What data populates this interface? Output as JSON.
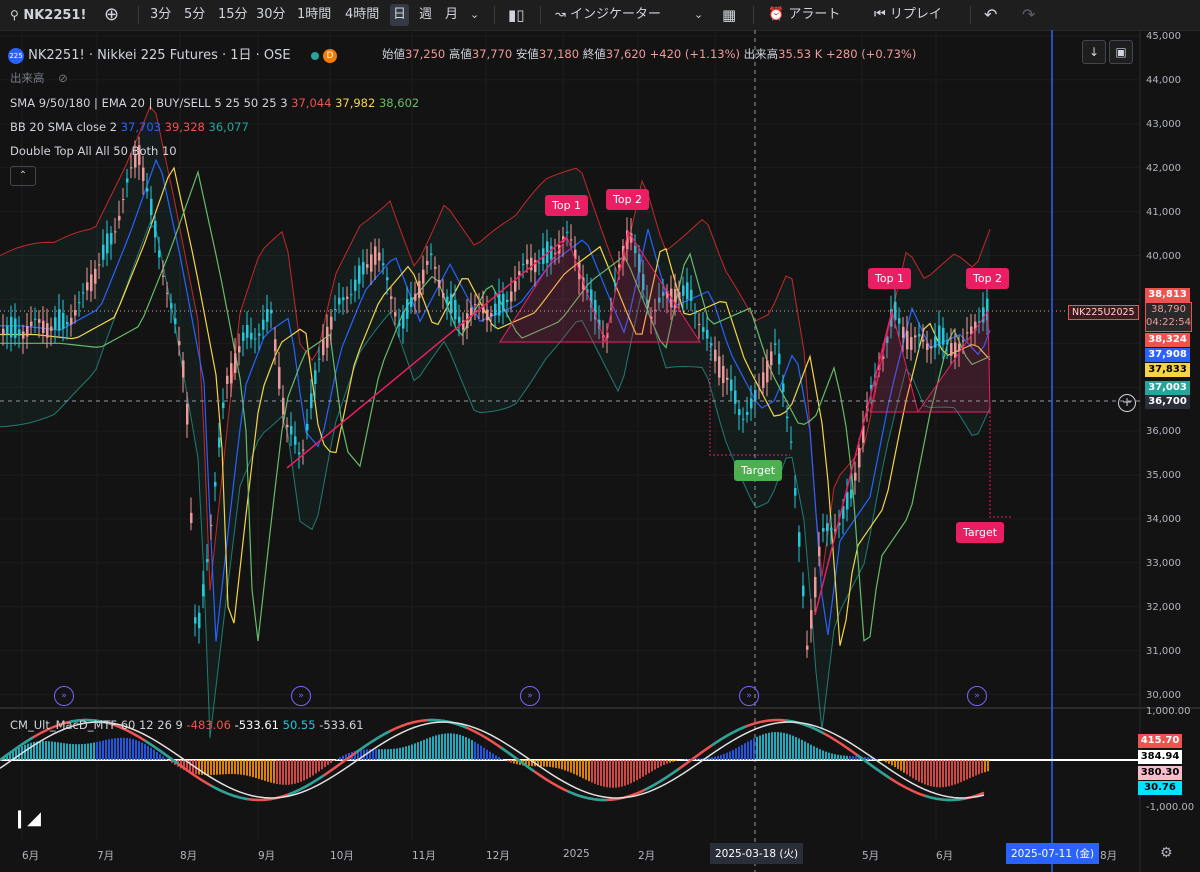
{
  "toolbar": {
    "symbol": "NK2251!",
    "intervals": [
      "3分",
      "5分",
      "15分",
      "30分",
      "1時間",
      "4時間",
      "日",
      "週",
      "月"
    ],
    "active_interval": "日",
    "indicators_label": "インジケーター",
    "alert_label": "アラート",
    "replay_label": "リプレイ"
  },
  "header": {
    "title": "NK2251! · Nikkei 225 Futures · 1日 · OSE",
    "open_label": "始値",
    "open": "37,250",
    "high_label": "高値",
    "high": "37,770",
    "low_label": "安値",
    "low": "37,180",
    "close_label": "終値",
    "close": "37,620",
    "change": "+420 (+1.13%)",
    "volume_label": "出来高",
    "volume": "35.53 K",
    "volume_change": "+280 (+0.73%)",
    "volume_row": "出来高"
  },
  "indicators": {
    "sma_label": "SMA 9/50/180 | EMA 20 | BUY/SELL 5 25 50 25 3",
    "sma_v1": "37,044",
    "sma_v2": "37,982",
    "sma_v3": "38,602",
    "bb_label": "BB 20 SMA close 2",
    "bb_v1": "37,703",
    "bb_v2": "39,328",
    "bb_v3": "36,077",
    "dt_label": "Double Top All All 50 Both 10",
    "macd_label": "CM_Ult_MacD_MTF 60 12 26 9",
    "macd_v1": "-483.06",
    "macd_v2": "-533.61",
    "macd_v3": "50.55",
    "macd_v4": "-533.61"
  },
  "pattern_labels": {
    "top1_a": "Top 1",
    "top2_a": "Top 2",
    "target_a": "Target",
    "top1_b": "Top 1",
    "top2_b": "Top 2",
    "target_b": "Target"
  },
  "price_axis": [
    "45,000",
    "44,000",
    "43,000",
    "42,000",
    "41,000",
    "40,000",
    "39,000",
    "38,000",
    "37,000",
    "36,000",
    "35,000",
    "34,000",
    "33,000",
    "32,000",
    "31,000",
    "30,000"
  ],
  "macd_axis": [
    "1,000.00",
    "-1,000.00"
  ],
  "price_boxes": {
    "symbol_tag": "NK225U2025",
    "p1": "38,813",
    "p2": "38,790",
    "p2_time": "04:22:54",
    "p3": "38,324",
    "p4": "37,908",
    "p5": "37,833",
    "p6": "37,003",
    "crosshair": "36,700"
  },
  "macd_boxes": {
    "m1": "415.70",
    "m2": "384.94",
    "m3": "380.30",
    "m4": "30.76"
  },
  "time_axis": [
    "6月",
    "7月",
    "8月",
    "9月",
    "10月",
    "11月",
    "12月",
    "2025",
    "2月",
    "3月",
    "5月",
    "6月",
    "8月"
  ],
  "crosshair_date": "2025-03-18 (火)",
  "future_date": "2025-07-11 (金)",
  "colors": {
    "up": "#26a69a",
    "down": "#ef5350",
    "accent": "#2962ff",
    "label_red": "#e91e63",
    "label_green": "#4caf50"
  }
}
